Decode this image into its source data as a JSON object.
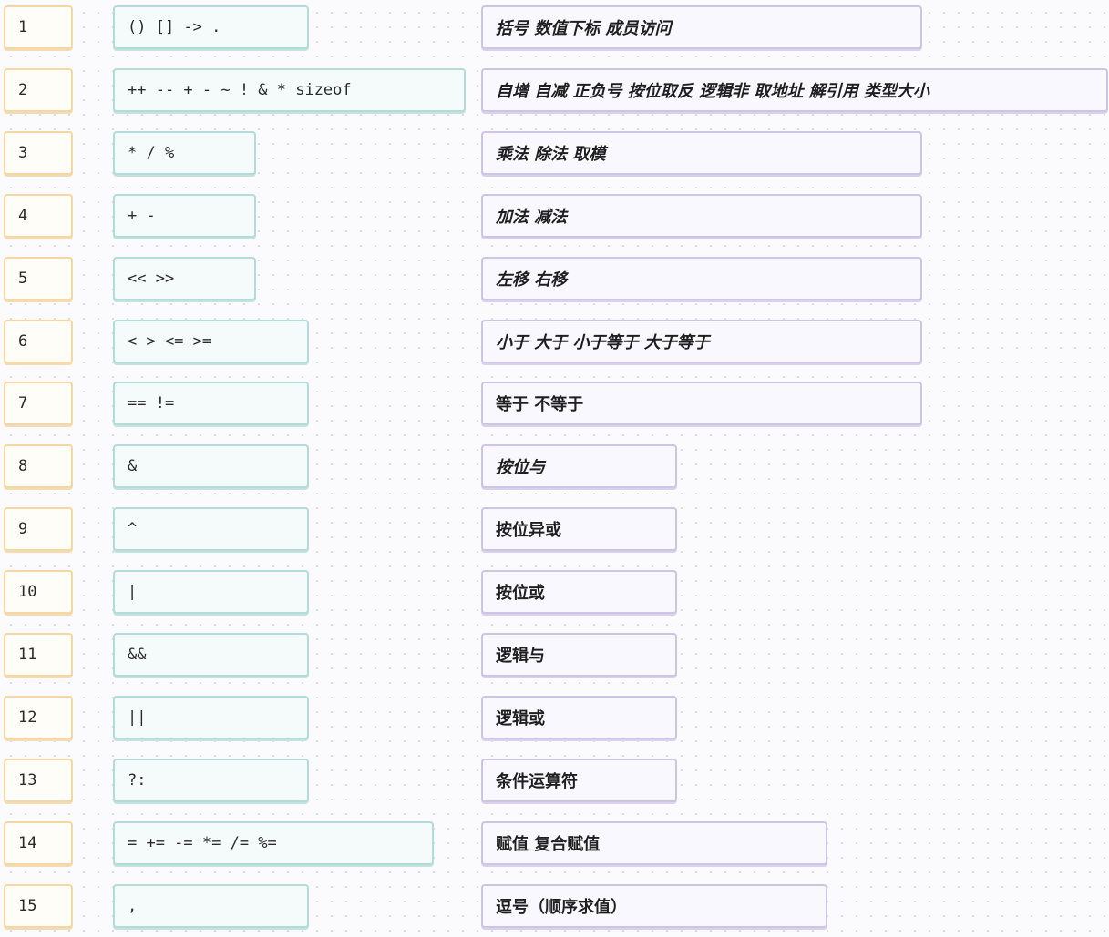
{
  "rows": [
    {
      "num": "1",
      "op": "() [] -> .",
      "desc": "括号 数值下标 成员访问",
      "italic": true
    },
    {
      "num": "2",
      "op": "++ -- + - ~ ! & * sizeof",
      "desc": "自增 自减 正负号 按位取反 逻辑非 取地址 解引用 类型大小",
      "italic": true
    },
    {
      "num": "3",
      "op": "* / %",
      "desc": "乘法 除法 取模",
      "italic": true
    },
    {
      "num": "4",
      "op": "+ -",
      "desc": "加法 减法",
      "italic": true
    },
    {
      "num": "5",
      "op": "<< >>",
      "desc": "左移 右移",
      "italic": true
    },
    {
      "num": "6",
      "op": "< > <= >=",
      "desc": "小于 大于 小于等于 大于等于",
      "italic": true
    },
    {
      "num": "7",
      "op": "== !=",
      "desc": "等于 不等于",
      "italic": false
    },
    {
      "num": "8",
      "op": "&",
      "desc": "按位与",
      "italic": true
    },
    {
      "num": "9",
      "op": "^",
      "desc": "按位异或",
      "italic": false
    },
    {
      "num": "10",
      "op": "|",
      "desc": "按位或",
      "italic": false
    },
    {
      "num": "11",
      "op": "&&",
      "desc": "逻辑与",
      "italic": false
    },
    {
      "num": "12",
      "op": "||",
      "desc": "逻辑或",
      "italic": false
    },
    {
      "num": "13",
      "op": "?:",
      "desc": "条件运算符",
      "italic": false
    },
    {
      "num": "14",
      "op": "= += -= *= /= %=",
      "desc": "赋值 复合赋值",
      "italic": false
    },
    {
      "num": "15",
      "op": ",",
      "desc": "逗号（顺序求值）",
      "italic": false
    }
  ]
}
